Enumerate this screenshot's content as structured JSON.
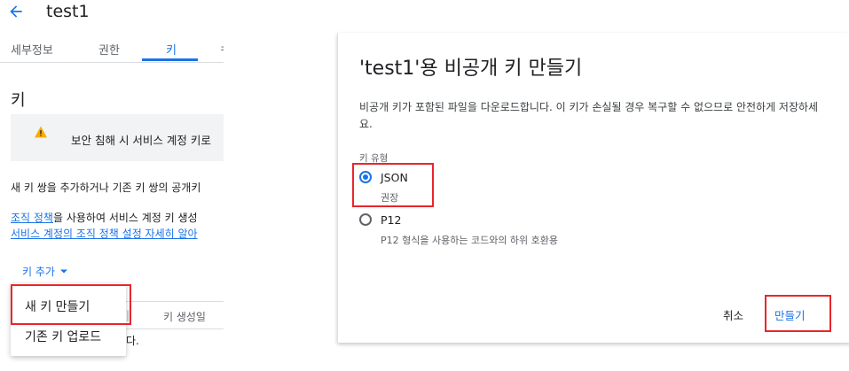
{
  "header": {
    "title": "test1"
  },
  "tabs": [
    {
      "label": "세부정보"
    },
    {
      "label": "권한"
    },
    {
      "label": "키"
    },
    {
      "label": "ㅋ"
    }
  ],
  "keys_section": {
    "heading": "키",
    "warning_text": "보안 침해 시 서비스 계정 키로",
    "line1": "새 키 쌍을 추가하거나 기존 키 쌍의 공개키",
    "line2_link": "조직 정책",
    "line2_rest": "을 사용하여 서비스 계정 키 생성",
    "line3_link": "서비스 계정의 조직 정책 설정 자세히 알아",
    "add_key_label": "키 추가",
    "table_headers": [
      "키 생성일"
    ],
    "table_partial": "다."
  },
  "add_key_menu": {
    "items": [
      {
        "label": "새 키 만들기"
      },
      {
        "label": "기존 키 업로드"
      }
    ]
  },
  "dialog": {
    "title": "'test1'용 비공개 키 만들기",
    "description": "비공개 키가 포함된 파일을 다운로드합니다. 이 키가 손실될 경우 복구할 수 없으므로 안전하게 저장하세요.",
    "key_type_label": "키 유형",
    "options": [
      {
        "label": "JSON",
        "sublabel": "권장",
        "selected": true
      },
      {
        "label": "P12",
        "sublabel": "P12 형식을 사용하는 코드와의 하위 호환용",
        "selected": false
      }
    ],
    "cancel_label": "취소",
    "create_label": "만들기"
  },
  "colors": {
    "accent": "#1a73e8",
    "highlight": "#e8262c",
    "warning": "#f9ab00"
  }
}
